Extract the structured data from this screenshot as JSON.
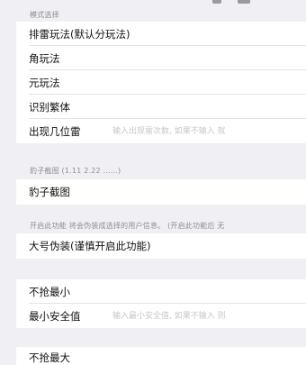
{
  "sections": {
    "mode": {
      "header": "模式选择",
      "rows": [
        {
          "label": "排雷玩法(默认分玩法)"
        },
        {
          "label": "角玩法"
        },
        {
          "label": "元玩法"
        },
        {
          "label": "识别繁体"
        },
        {
          "label": "出现几位雷",
          "placeholder": "输入出现雷次数, 如果不输入 就"
        }
      ]
    },
    "screenshot": {
      "header": "豹子截图 (1.11 2.22 ......)",
      "rows": [
        {
          "label": "豹子截图"
        }
      ]
    },
    "disguise": {
      "header": "开启此功能 将会伪装成选择的用户信息。 (开启此功能后 无",
      "rows": [
        {
          "label": "大号伪装(谨慎开启此功能)"
        }
      ]
    },
    "min": {
      "rows": [
        {
          "label": "不抢最小"
        },
        {
          "label": "最小安全值",
          "placeholder": "输入最小安全值, 如果不输入 则"
        }
      ]
    },
    "bottom": {
      "label": "不抢最大"
    }
  }
}
